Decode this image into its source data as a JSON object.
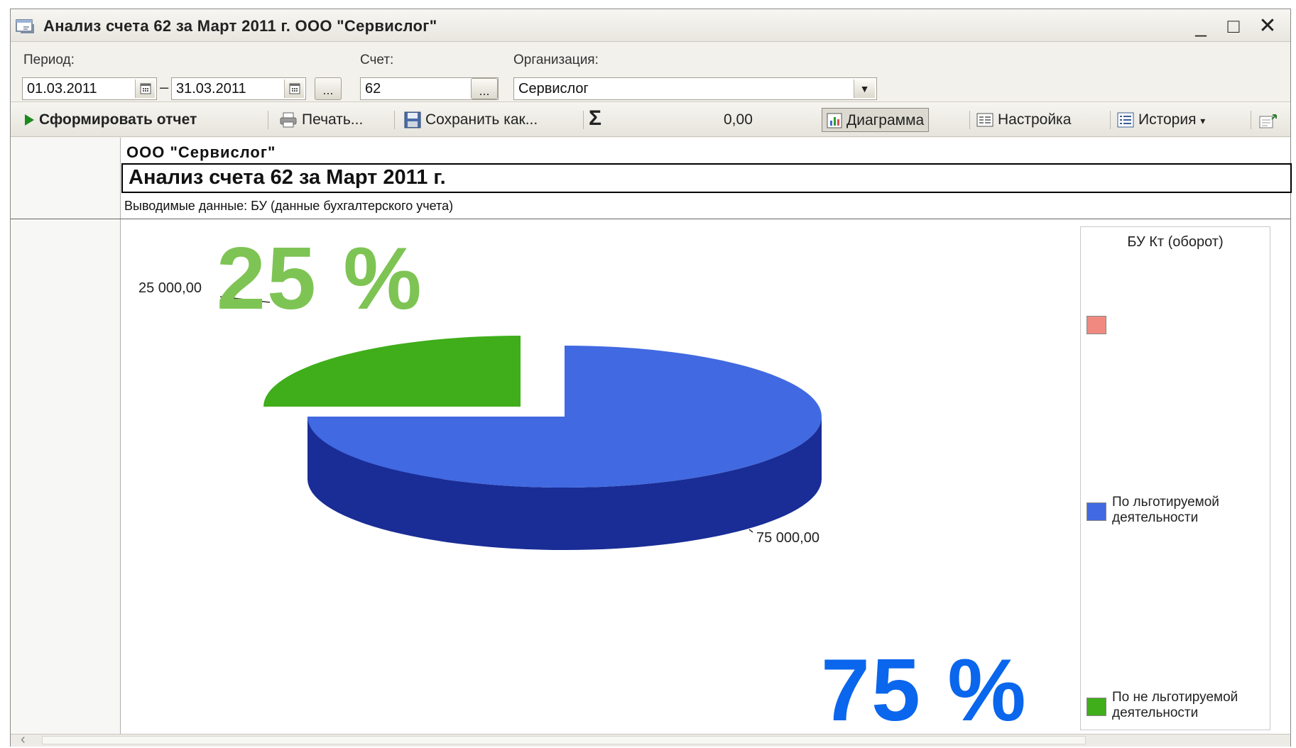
{
  "window": {
    "title": "Анализ счета 62 за Март 2011 г. ООО \"Сервислог\"",
    "controls": {
      "minimize": "_",
      "maximize": "□",
      "close": "✕"
    }
  },
  "params": {
    "period_label": "Период:",
    "date_from": "01.03.2011",
    "date_to": "31.03.2011",
    "dash": "–",
    "more": "...",
    "account_label": "Счет:",
    "account_value": "62",
    "org_label": "Организация:",
    "org_value": "Сервислог"
  },
  "toolbar": {
    "generate": "Сформировать отчет",
    "print": "Печать...",
    "save_as": "Сохранить как...",
    "sigma": "Σ",
    "sum": "0,00",
    "chart": "Диаграмма",
    "settings": "Настройка",
    "history": "История"
  },
  "report": {
    "org": "ООО \"Сервислог\"",
    "title": "Анализ счета 62 за Март 2011 г.",
    "output_data": "Выводимые данные:  БУ (данные бухгалтерского учета)"
  },
  "chart_data": {
    "type": "pie",
    "title": "",
    "legend_title": "БУ Кт (оборот)",
    "legend_position": "right",
    "categories": [
      "",
      "По льготируемой деятельности",
      "По не льготируемой деятельности"
    ],
    "values": [
      0,
      75000,
      25000
    ],
    "value_labels": [
      "",
      "75 000,00",
      "25 000,00"
    ],
    "colors": [
      "#f08a80",
      "#4169e1",
      "#3fae1a"
    ],
    "dark_colors": [
      "#b05a52",
      "#1a2d96",
      "#0b1a08"
    ]
  },
  "annotations": {
    "pct_small": "25 %",
    "pct_large": "75 %"
  }
}
